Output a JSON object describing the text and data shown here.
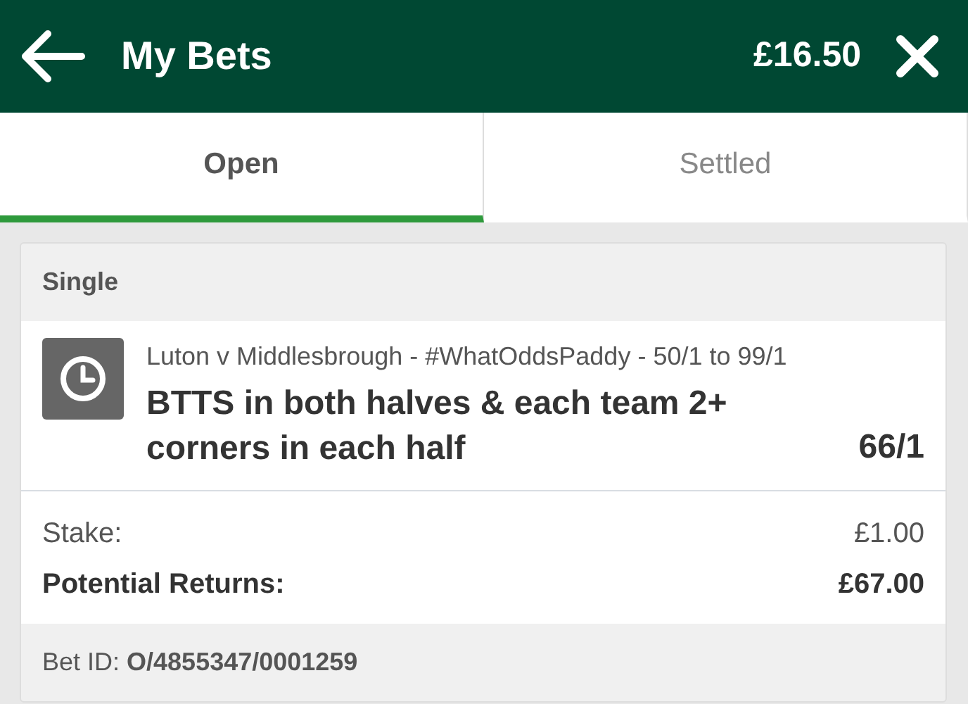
{
  "header": {
    "title": "My Bets",
    "balance": "£16.50"
  },
  "tabs": [
    {
      "label": "Open",
      "selected": true
    },
    {
      "label": "Settled",
      "selected": false
    }
  ],
  "bet": {
    "type": "Single",
    "event": "Luton v Middlesbrough - #WhatOddsPaddy - 50/1 to 99/1",
    "selection": "BTTS in both halves & each team 2+ corners in each half",
    "odds": "66/1",
    "rows": [
      {
        "kind": "plain",
        "label": "Stake:",
        "value": "£1.00"
      },
      {
        "kind": "total",
        "label": "Potential Returns:",
        "value": "£67.00"
      }
    ],
    "bet_id": "Bet ID: **O/4855347/0001259**"
  }
}
